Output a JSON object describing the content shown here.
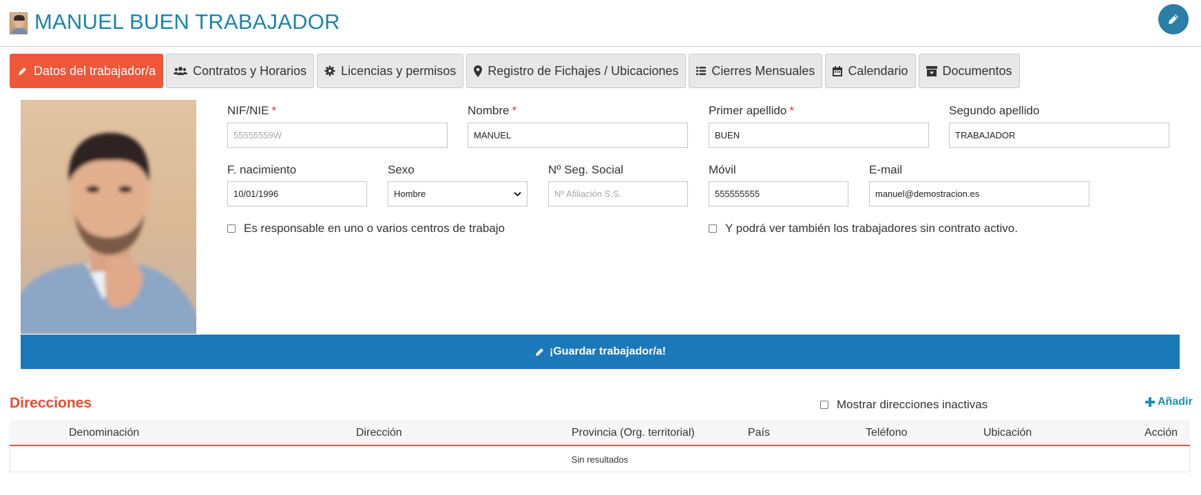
{
  "header": {
    "title": "MANUEL BUEN TRABAJADOR"
  },
  "tabs": [
    {
      "label": "Datos del trabajador/a",
      "icon": "pencil-icon",
      "active": true
    },
    {
      "label": "Contratos y Horarios",
      "icon": "users-icon",
      "active": false
    },
    {
      "label": "Licencias y permisos",
      "icon": "gear-icon",
      "active": false
    },
    {
      "label": "Registro de Fichajes / Ubicaciones",
      "icon": "map-marker-icon",
      "active": false
    },
    {
      "label": "Cierres Mensuales",
      "icon": "list-icon",
      "active": false
    },
    {
      "label": "Calendario",
      "icon": "calendar-icon",
      "active": false
    },
    {
      "label": "Documentos",
      "icon": "archive-icon",
      "active": false
    }
  ],
  "form": {
    "nif": {
      "label": "NIF/NIE",
      "value": "",
      "placeholder": "55555559W",
      "required": "*"
    },
    "nombre": {
      "label": "Nombre",
      "value": "MANUEL",
      "required": "*"
    },
    "primer_apellido": {
      "label": "Primer apellido",
      "value": "BUEN",
      "required": "*"
    },
    "segundo_apellido": {
      "label": "Segundo apellido",
      "value": "TRABAJADOR"
    },
    "nacimiento": {
      "label": "F. nacimiento",
      "value": "10/01/1996"
    },
    "sexo": {
      "label": "Sexo",
      "value": "Hombre"
    },
    "seg_social": {
      "label": "Nº Seg. Social",
      "value": "",
      "placeholder": "Nº Afiliación S.S."
    },
    "movil": {
      "label": "Móvil",
      "value": "555555555"
    },
    "email": {
      "label": "E-mail",
      "value": "manuel@demostracion.es"
    },
    "responsable": {
      "label": "Es responsable en uno o varios centros de trabajo",
      "checked": false
    },
    "ver_sin_contrato": {
      "label": "Y podrá ver también los trabajadores sin contrato activo.",
      "checked": false
    }
  },
  "save_button": {
    "label": "¡Guardar trabajador/a!"
  },
  "direcciones": {
    "title": "Direcciones",
    "show_inactive_label": "Mostrar direcciones inactivas",
    "add_label": "Añadir",
    "columns": [
      "Denominación",
      "Dirección",
      "Provincia (Org. territorial)",
      "País",
      "Teléfono",
      "Ubicación",
      "Acción"
    ],
    "empty_text": "Sin resultados"
  },
  "colors": {
    "title": "#1b84aa",
    "active_tab": "#f0563a",
    "save_bar": "#1c79b9",
    "section_title": "#ef4a2d",
    "required": "#e0323a"
  }
}
